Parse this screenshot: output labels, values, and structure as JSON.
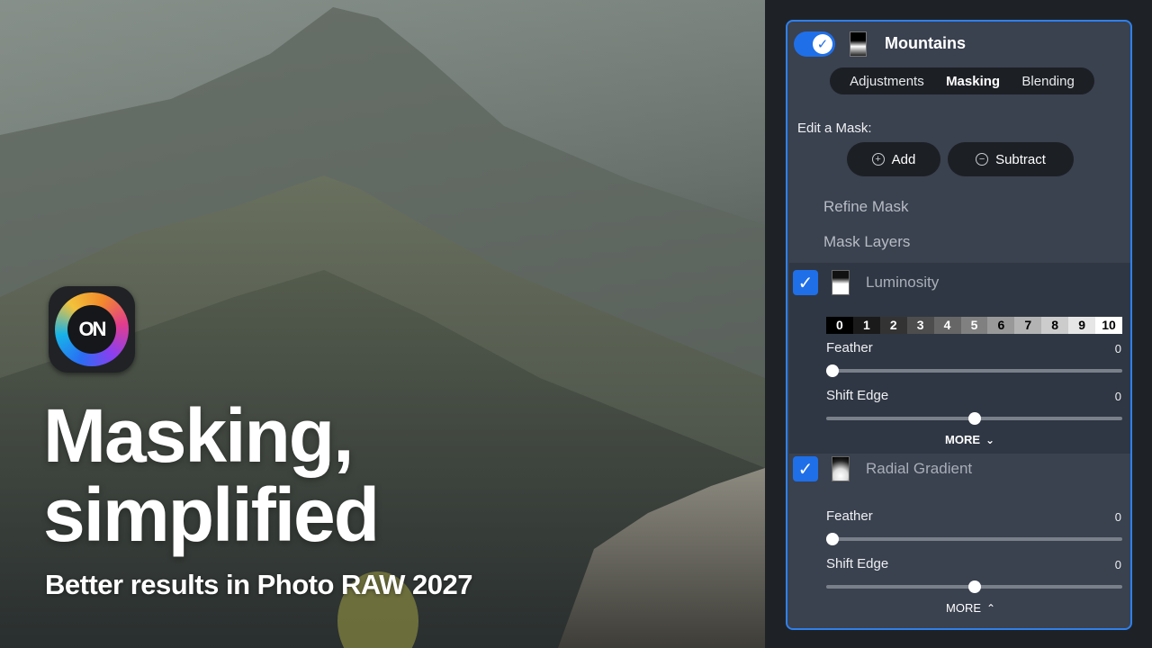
{
  "hero": {
    "logo_text": "ON",
    "title": "Masking,\nsimplified",
    "subtitle": "Better results in Photo RAW 2027"
  },
  "panel": {
    "layer_name": "Mountains",
    "tabs": [
      {
        "label": "Adjustments",
        "active": false
      },
      {
        "label": "Masking",
        "active": true
      },
      {
        "label": "Blending",
        "active": false
      }
    ],
    "edit_mask_label": "Edit a Mask:",
    "add_button": "Add",
    "subtract_button": "Subtract",
    "add_icon": "+",
    "subtract_icon": "−",
    "refine_mask": "Refine Mask",
    "mask_layers": "Mask Layers",
    "masks": [
      {
        "name": "Luminosity",
        "checked": true,
        "luminosity_scale": [
          "0",
          "1",
          "2",
          "3",
          "4",
          "5",
          "6",
          "7",
          "8",
          "9",
          "10"
        ],
        "feather_label": "Feather",
        "feather_value": "0",
        "feather_level": 0,
        "shift_label": "Shift Edge",
        "shift_value": "0",
        "shift_level": 0.5,
        "more_label": "MORE",
        "more_icon": "chevron-down-icon"
      },
      {
        "name": "Radial Gradient",
        "checked": true,
        "feather_label": "Feather",
        "feather_value": "0",
        "feather_level": 0,
        "shift_label": "Shift Edge",
        "shift_value": "0",
        "shift_level": 0.5,
        "more_label": "MORE",
        "more_icon": "chevron-up-icon"
      }
    ]
  },
  "colors": {
    "accent": "#2f80ed",
    "toggle": "#1f6fe8",
    "panel_bg": "#3a414f",
    "section_bg": "#303744",
    "pill_bg": "#1c1f24"
  }
}
